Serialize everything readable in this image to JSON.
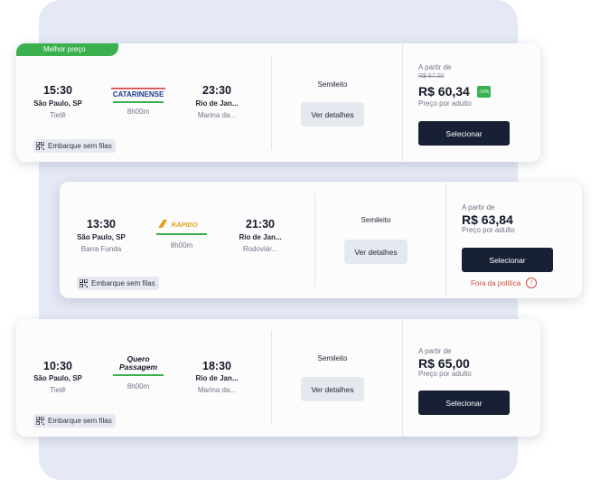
{
  "trips": [
    {
      "badge": "Melhor preço",
      "departure": {
        "time": "15:30",
        "city": "São Paulo, SP",
        "station": "Tietê"
      },
      "arrival": {
        "time": "23:30",
        "city": "Rio de Jan...",
        "station": "Marina da..."
      },
      "company": "CATARINENSE",
      "duration": "8h00m",
      "boarding": "Embarque sem filas",
      "seat_class": "Semileito",
      "details_label": "Ver detalhes",
      "from_label": "A partir de",
      "old_price": "R$ 67,00",
      "price": "R$ 60,34",
      "discount": "-10%",
      "per_adult": "Preço por adulto",
      "select_label": "Selecionar"
    },
    {
      "departure": {
        "time": "13:30",
        "city": "São Paulo, SP",
        "station": "Barra Funda"
      },
      "arrival": {
        "time": "21:30",
        "city": "Rio de Jan...",
        "station": "Rodoviár..."
      },
      "company": "RAPIDO",
      "duration": "8h00m",
      "boarding": "Embarque sem filas",
      "seat_class": "Semileito",
      "details_label": "Ver detalhes",
      "from_label": "A partir de",
      "price": "R$ 63,84",
      "per_adult": "Preço por adulto",
      "select_label": "Selecionar",
      "policy": "Fora da política",
      "policy_icon": "!"
    },
    {
      "departure": {
        "time": "10:30",
        "city": "São Paulo, SP",
        "station": "Tietê"
      },
      "arrival": {
        "time": "18:30",
        "city": "Rio de Jan...",
        "station": "Marina da..."
      },
      "company_line1": "Quero",
      "company_line2": "Passagem",
      "duration": "8h00m",
      "boarding": "Embarque sem filas",
      "seat_class": "Semileito",
      "details_label": "Ver detalhes",
      "from_label": "A partir de",
      "price": "R$ 65,00",
      "per_adult": "Preço por adulto",
      "select_label": "Selecionar"
    }
  ],
  "icons": {
    "boarding": "qr-code-icon",
    "policy": "info-circle-icon"
  },
  "colors": {
    "accent_green": "#3bb04f",
    "button_dark": "#182033",
    "warning_red": "#d04a3a",
    "backdrop": "#e5e9f6"
  }
}
